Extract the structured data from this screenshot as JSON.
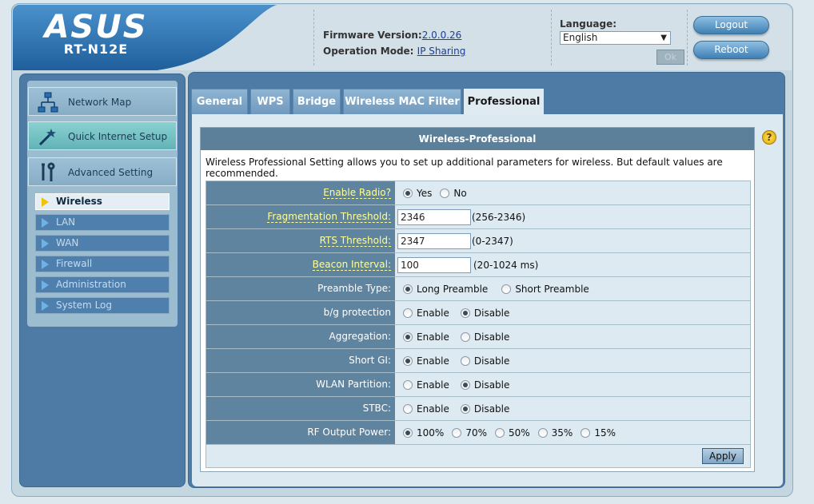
{
  "header": {
    "brand": "ASUS",
    "model": "RT-N12E",
    "firmware_label": "Firmware Version:",
    "firmware_value": "2.0.0.26",
    "mode_label": "Operation Mode:",
    "mode_value": "IP Sharing",
    "language_label": "Language:",
    "language_value": "English",
    "ok_label": "Ok",
    "logout_label": "Logout",
    "reboot_label": "Reboot"
  },
  "sidebar": {
    "main_items": [
      {
        "label": "Network Map",
        "icon": "network-map-icon"
      },
      {
        "label": "Quick Internet Setup",
        "icon": "magic-wand-icon"
      },
      {
        "label": "Advanced Setting",
        "icon": "tools-icon"
      }
    ],
    "sub_items": [
      {
        "label": "Wireless"
      },
      {
        "label": "LAN"
      },
      {
        "label": "WAN"
      },
      {
        "label": "Firewall"
      },
      {
        "label": "Administration"
      },
      {
        "label": "System Log"
      }
    ]
  },
  "tabs": [
    {
      "label": "General"
    },
    {
      "label": "WPS"
    },
    {
      "label": "Bridge"
    },
    {
      "label": "Wireless MAC Filter"
    },
    {
      "label": "Professional"
    }
  ],
  "panel": {
    "title": "Wireless-Professional",
    "description": "Wireless Professional Setting allows you to set up additional parameters for wireless. But default values are recommended.",
    "rows": [
      {
        "label": "Enable Radio?",
        "options": [
          "Yes",
          "No"
        ]
      },
      {
        "label": "Fragmentation Threshold:",
        "value": "2346",
        "hint": "(256-2346)"
      },
      {
        "label": "RTS Threshold:",
        "value": "2347",
        "hint": "(0-2347)"
      },
      {
        "label": "Beacon Interval:",
        "value": "100",
        "hint": "(20-1024 ms)"
      },
      {
        "label": "Preamble Type:",
        "options": [
          "Long Preamble",
          "Short Preamble"
        ]
      },
      {
        "label": "b/g protection",
        "options": [
          "Enable",
          "Disable"
        ]
      },
      {
        "label": "Aggregation:",
        "options": [
          "Enable",
          "Disable"
        ]
      },
      {
        "label": "Short GI:",
        "options": [
          "Enable",
          "Disable"
        ]
      },
      {
        "label": "WLAN Partition:",
        "options": [
          "Enable",
          "Disable"
        ]
      },
      {
        "label": "STBC:",
        "options": [
          "Enable",
          "Disable"
        ]
      },
      {
        "label": "RF Output Power:",
        "options": [
          "100%",
          "70%",
          "50%",
          "35%",
          "15%"
        ]
      }
    ],
    "apply_label": "Apply",
    "help_label": "?"
  },
  "colors": {
    "sidebar_bg": "#4d7ba6",
    "label_col_bg": "#5f849f",
    "advanced_label": "#ffff99",
    "value_col_bg": "#ddeaf2"
  }
}
